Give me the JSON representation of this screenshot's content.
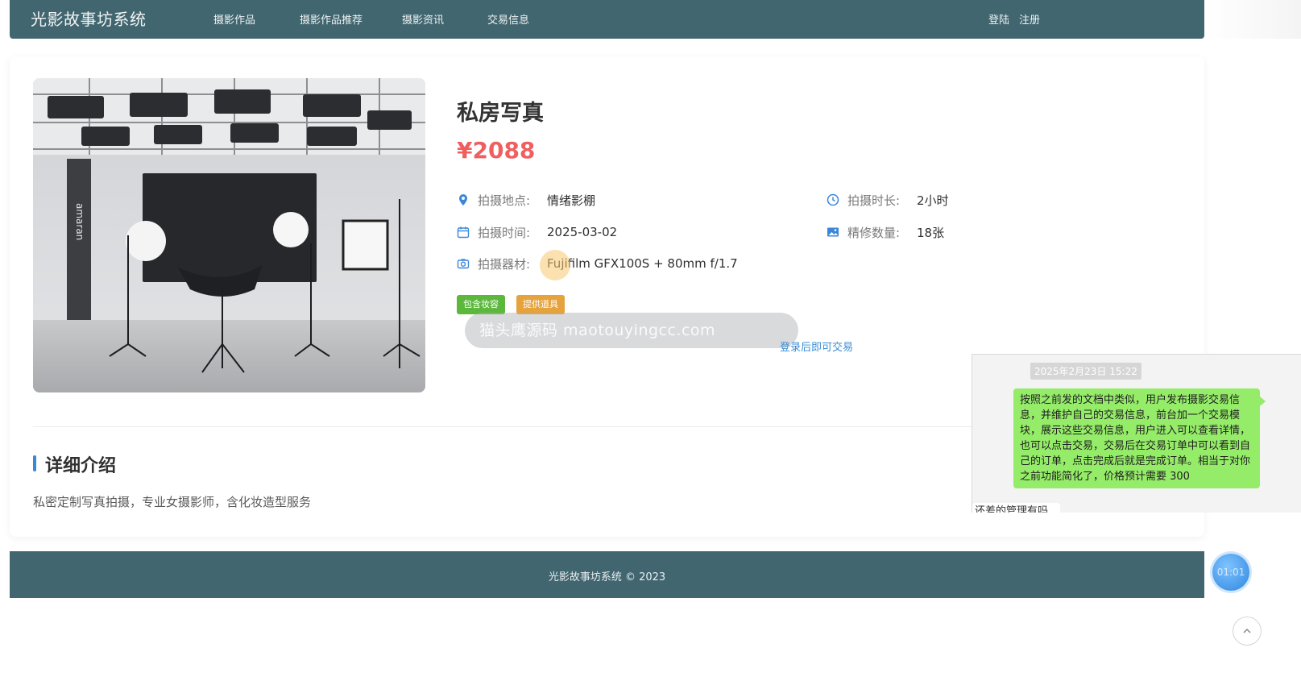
{
  "header": {
    "brand": "光影故事坊系统",
    "nav": [
      "摄影作品",
      "摄影作品推荐",
      "摄影资讯",
      "交易信息"
    ],
    "login": "登陆",
    "register": "注册"
  },
  "product": {
    "title": "私房写真",
    "price": "¥2088",
    "info": {
      "location_label": "拍摄地点:",
      "location_value": "情绪影棚",
      "duration_label": "拍摄时长:",
      "duration_value": "2小时",
      "time_label": "拍摄时间:",
      "time_value": "2025-03-02",
      "retouch_label": "精修数量:",
      "retouch_value": "18张",
      "gear_label": "拍摄器材:",
      "gear_value": "Fujifilm GFX100S + 80mm f/1.7"
    },
    "tags": [
      "包含妆容",
      "提供道具"
    ],
    "watermark": "猫头鹰源码 maotouyingcc.com",
    "login_to_trade": "登录后即可交易",
    "image_brand_text": "amaran"
  },
  "details": {
    "heading": "详细介绍",
    "description": "私密定制写真拍摄，专业女摄影师，含化妆造型服务"
  },
  "chat": {
    "time": "2025年2月23日 15:22",
    "message": "按照之前发的文档中类似，用户发布摄影交易信息，并维护自己的交易信息，前台加一个交易模块，展示这些交易信息，用户进入可以查看详情，也可以点击交易，交易后在交易订单中可以看到自己的订单，点击完成后就是完成订单。相当于对你之前功能简化了，价格预计需要 300",
    "partial_reply": "还差的管理有吗"
  },
  "footer": {
    "copyright": "光影故事坊系统 © 2023"
  },
  "timer": {
    "value": "01:01"
  },
  "colors": {
    "nav_bg": "#416670",
    "price": "#ef5f5f",
    "tag_green": "#5cb83c",
    "tag_orange": "#e6a23c",
    "link": "#3b8ed6",
    "icon_blue": "#3a86d8",
    "chat_bubble": "#95ec69"
  }
}
